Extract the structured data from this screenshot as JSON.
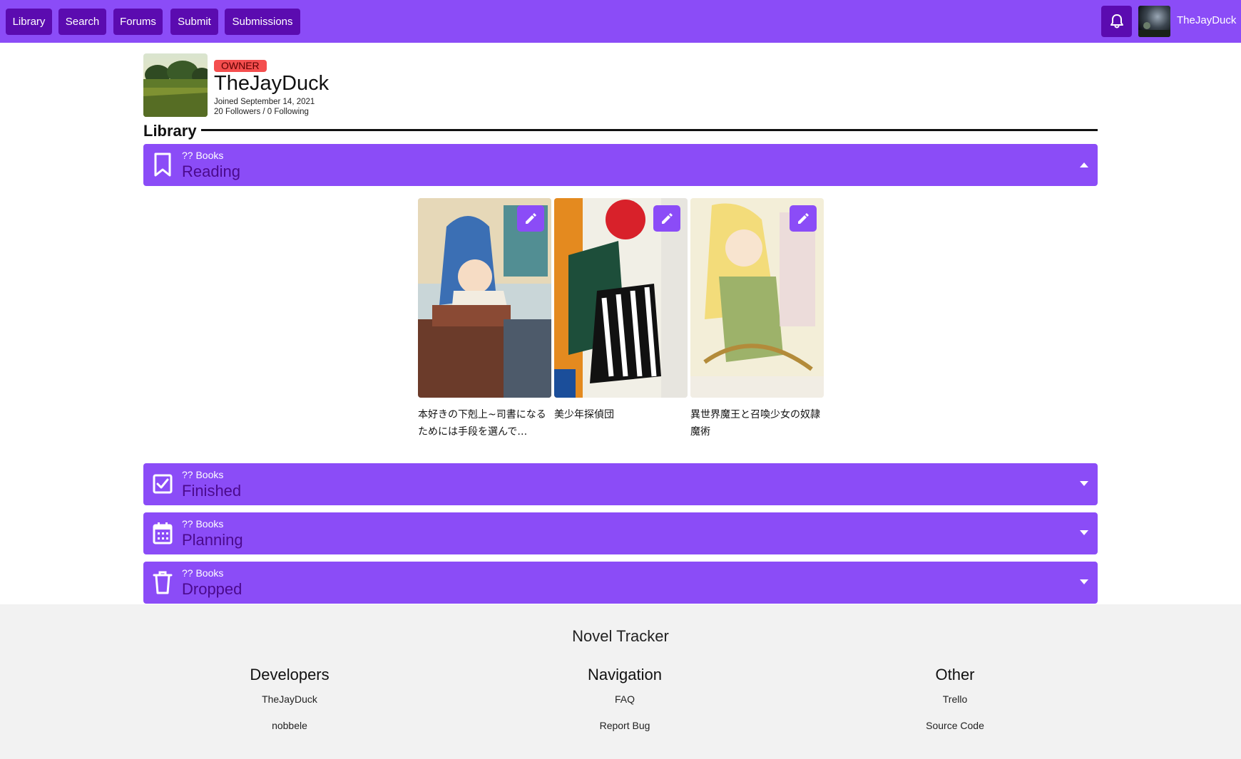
{
  "nav": {
    "items": [
      {
        "label": "Library"
      },
      {
        "label": "Search"
      },
      {
        "label": "Forums"
      },
      {
        "label": "Submit"
      },
      {
        "label": "Submissions"
      }
    ],
    "username": "TheJayDuck",
    "icons": {
      "bell": "bell-icon"
    }
  },
  "profile": {
    "badge": "OWNER",
    "name": "TheJayDuck",
    "joined": "Joined September 14, 2021",
    "follow": "20 Followers / 0 Following"
  },
  "library": {
    "heading": "Library",
    "sections": [
      {
        "count": "?? Books",
        "name": "Reading",
        "icon": "bookmark-icon",
        "state": "expanded"
      },
      {
        "count": "?? Books",
        "name": "Finished",
        "icon": "checkbox-icon",
        "state": "collapsed"
      },
      {
        "count": "?? Books",
        "name": "Planning",
        "icon": "calendar-icon",
        "state": "collapsed"
      },
      {
        "count": "?? Books",
        "name": "Dropped",
        "icon": "trash-icon",
        "state": "collapsed"
      }
    ],
    "reading_books": [
      {
        "title": "本好きの下剋上~司書になるためには手段を選んで…"
      },
      {
        "title": "美少年探偵団"
      },
      {
        "title": "異世界魔王と召喚少女の奴隷魔術"
      }
    ]
  },
  "footer": {
    "brand": "Novel Tracker",
    "columns": [
      {
        "title": "Developers",
        "links": [
          "TheJayDuck",
          "nobbele"
        ]
      },
      {
        "title": "Navigation",
        "links": [
          "FAQ",
          "Report Bug"
        ]
      },
      {
        "title": "Other",
        "links": [
          "Trello",
          "Source Code"
        ]
      }
    ]
  },
  "colors": {
    "accent": "#8b4cf7",
    "nav_button": "#5b0bb0",
    "badge": "#f44e4e",
    "section_label": "#4b0a8c",
    "footer_bg": "#f2f2f2"
  }
}
